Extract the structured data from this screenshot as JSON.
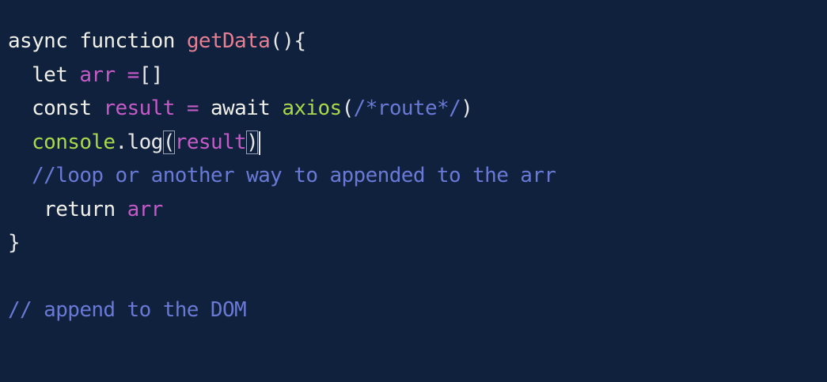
{
  "colors": {
    "background": "#0f213d",
    "keyword": "#f0f0e8",
    "function_name": "#e77f93",
    "variable": "#c65bc8",
    "call": "#a8d94a",
    "comment": "#6a79d6"
  },
  "code": {
    "line1": {
      "kw_async": "async",
      "kw_function": "function",
      "fn_name": "getData",
      "tail": "(){"
    },
    "line2": {
      "indent": "  ",
      "kw_let": "let",
      "var_arr": "arr",
      "op": "=",
      "tail": "[]"
    },
    "line3": {
      "indent": "  ",
      "kw_const": "const",
      "var_result": "result",
      "op": "=",
      "kw_await": "await",
      "fn_axios": "axios",
      "paren_open": "(",
      "comment": "/*route*/",
      "paren_close": ")"
    },
    "line4": {
      "indent": "  ",
      "obj": "console",
      "dot": ".",
      "method": "log",
      "paren_open": "(",
      "arg": "result",
      "paren_close": ")"
    },
    "line5": {
      "indent": "  ",
      "comment": "//loop or another way to appended to the arr"
    },
    "line6": {
      "indent": "   ",
      "kw_return": "return",
      "var_arr": "arr"
    },
    "line7": {
      "tail": "}"
    },
    "line9": {
      "comment": "// append to the DOM"
    }
  }
}
